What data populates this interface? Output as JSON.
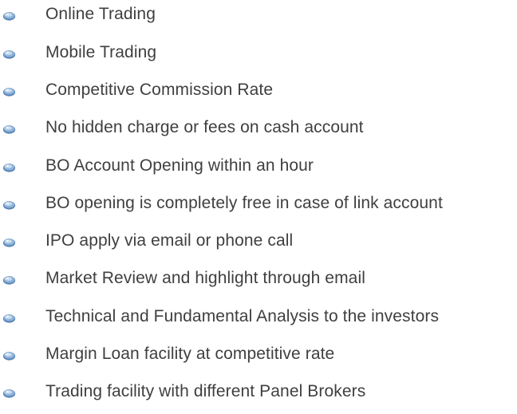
{
  "features": {
    "bullet_icon": "blue-gem-bullet-icon",
    "colors": {
      "text": "#3f3f3f",
      "bullet_light": "#c9dcef",
      "bullet_mid": "#8fb3d9",
      "bullet_dark": "#5b86b8"
    },
    "items": [
      {
        "label": "Online Trading"
      },
      {
        "label": "Mobile Trading"
      },
      {
        "label": "Competitive Commission Rate"
      },
      {
        "label": "No hidden charge or fees on cash account"
      },
      {
        "label": "BO Account Opening within an hour"
      },
      {
        "label": "BO opening is completely free in case of link account"
      },
      {
        "label": "IPO apply via email or phone call"
      },
      {
        "label": "Market Review and highlight through email"
      },
      {
        "label": "Technical and Fundamental Analysis to the investors"
      },
      {
        "label": "Margin Loan facility at competitive rate"
      },
      {
        "label": "Trading facility with different Panel Brokers"
      }
    ]
  }
}
